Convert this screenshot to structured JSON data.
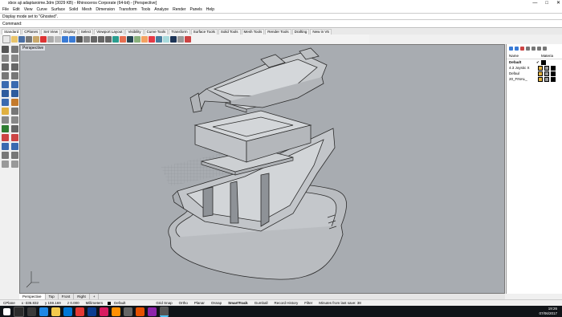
{
  "window": {
    "title": "xbox aji adaptaroime.3dm (3029 KB) - Rhinoceros Corporate (64-bit) - [Perspective]",
    "controls": [
      "—",
      "□",
      "✕"
    ]
  },
  "menu": [
    "File",
    "Edit",
    "View",
    "Curve",
    "Surface",
    "Solid",
    "Mesh",
    "Dimension",
    "Transform",
    "Tools",
    "Analyze",
    "Render",
    "Panels",
    "Help"
  ],
  "command_history": "Display mode set to \"Ghosted\".",
  "command_prompt": "Command:",
  "toolbar_tabs": [
    "Standard",
    "CPlanes",
    "Set View",
    "Display",
    "Select",
    "Viewport Layout",
    "Visibility",
    "Curve Tools",
    "Transform",
    "Surface Tools",
    "Solid Tools",
    "Mesh Tools",
    "Render Tools",
    "Drafting",
    "New in V5"
  ],
  "viewport": {
    "label": "Perspective",
    "mode": "Ghosted"
  },
  "layers_panel": {
    "headers": [
      "Name",
      "Materia"
    ],
    "rows": [
      {
        "name": "Default",
        "check": "✔",
        "color": "#000000"
      },
      {
        "name": "4.3 Joystic X",
        "check": "",
        "color": "#000000"
      },
      {
        "name": "Defaul",
        "check": "",
        "color": "#000000"
      },
      {
        "name": "20_FINAL_",
        "check": "",
        "color": "#000000"
      }
    ]
  },
  "view_tabs": [
    "Perspective",
    "Top",
    "Front",
    "Right",
    "+"
  ],
  "status": {
    "cplane": "CPlane",
    "x": "x -336.832",
    "y": "y 159.169",
    "z": "z 0.000",
    "units": "Millimeters",
    "layer": "Default",
    "toggles": [
      "Grid Snap",
      "Ortho",
      "Planar",
      "Osnap",
      "SmartTrack",
      "Gumball",
      "Record History",
      "Filter"
    ],
    "save": "Minutes from last save: 38"
  },
  "taskbar": {
    "time": "19:26",
    "date": "07/06/2017"
  },
  "colors": {
    "viewport_bg": "#a8acb1",
    "taskbar": "#101418",
    "active_tab": "#ffffff"
  }
}
